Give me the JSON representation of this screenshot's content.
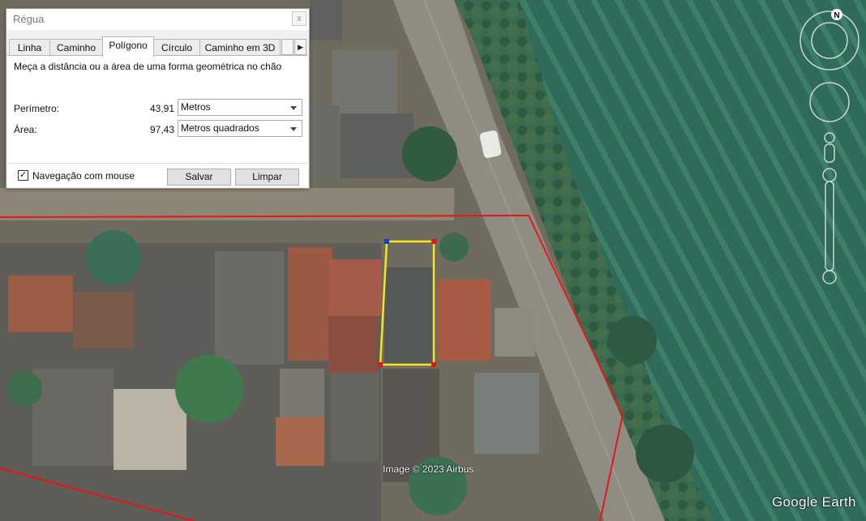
{
  "dialog": {
    "title": "Régua",
    "close_glyph": "x",
    "tabs": [
      {
        "label": "Linha",
        "active": false
      },
      {
        "label": "Caminho",
        "active": false
      },
      {
        "label": "Polígono",
        "active": true
      },
      {
        "label": "Círculo",
        "active": false
      },
      {
        "label": "Caminho em 3D",
        "active": false
      }
    ],
    "tab_scroll_right_glyph": "▶",
    "description": "Meça a distância ou a área de uma forma geométrica no chão",
    "perimeter": {
      "label": "Perímetro:",
      "value": "43,91",
      "unit": "Metros"
    },
    "area": {
      "label": "Área:",
      "value": "97,43",
      "unit": "Metros quadrados"
    },
    "mouse_nav": {
      "label": "Navegação com mouse",
      "checked": true,
      "check_glyph": "✓"
    },
    "save_label": "Salvar",
    "clear_label": "Limpar"
  },
  "map": {
    "image_credit": "Image © 2023 Airbus",
    "brand": "Google Earth",
    "north_label": "N",
    "colors": {
      "boundary_line": "#e8141b",
      "polygon_stroke": "#f5e61a",
      "vertex_start": "#1a3ad6",
      "vertex": "#e8141b"
    }
  }
}
